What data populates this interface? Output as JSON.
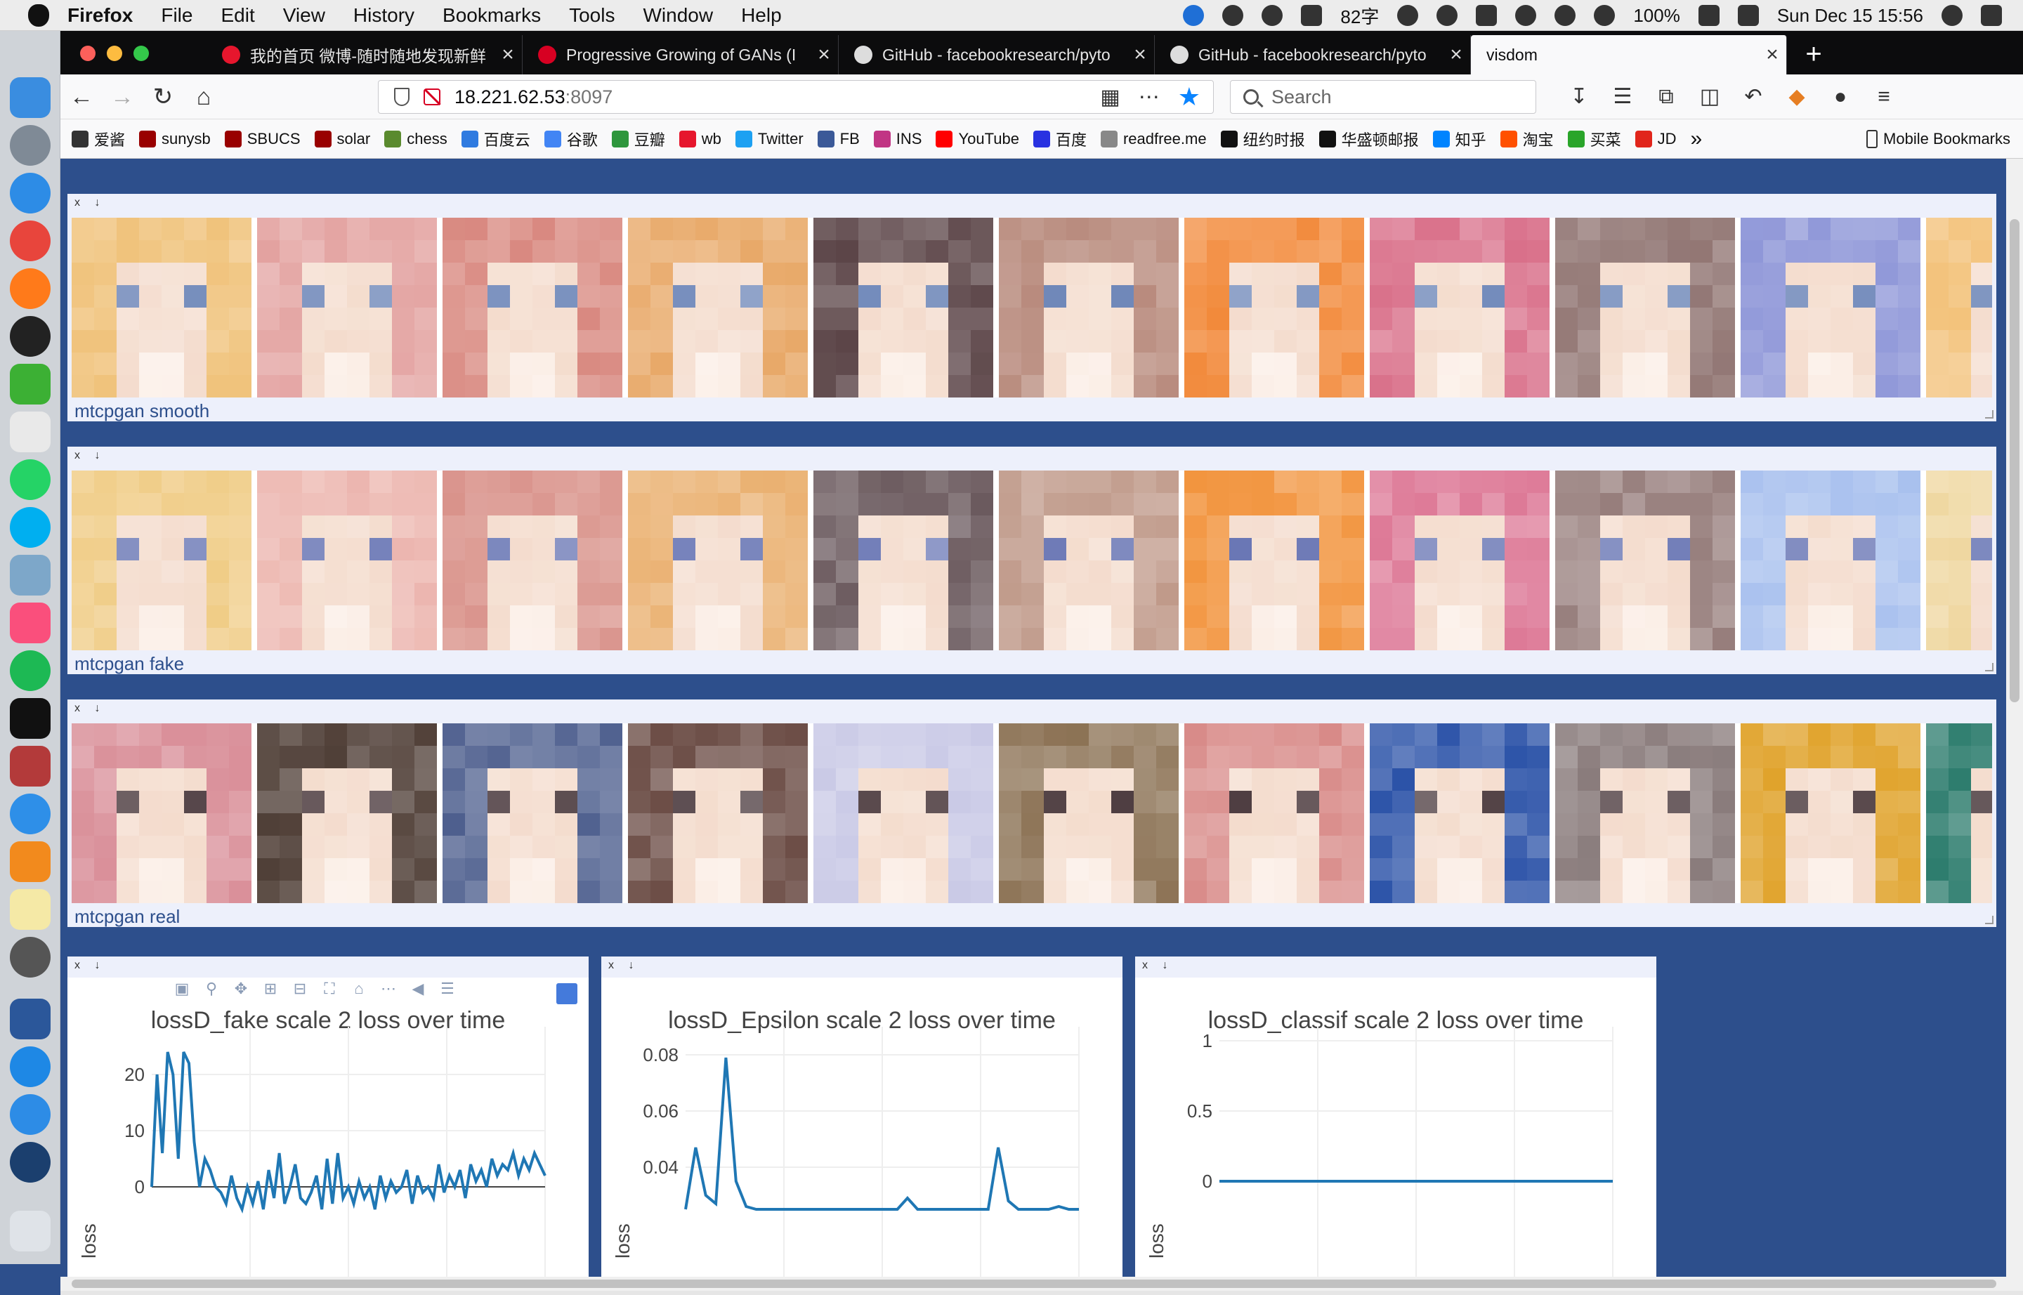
{
  "menubar": {
    "app": "Firefox",
    "items": [
      "File",
      "Edit",
      "View",
      "History",
      "Bookmarks",
      "Tools",
      "Window",
      "Help"
    ],
    "word_count": "82字",
    "battery": "100%",
    "clock": "Sun Dec 15  15:56"
  },
  "browser": {
    "tabs": [
      {
        "title": "我的首页 微博-随时随地发现新鲜",
        "fav_color": "#e6162d"
      },
      {
        "title": "Progressive Growing of GANs (I",
        "fav_color": "#d70022"
      },
      {
        "title": "GitHub - facebookresearch/pyto",
        "fav_color": "#ffffff"
      },
      {
        "title": "GitHub - facebookresearch/pyto",
        "fav_color": "#ffffff"
      },
      {
        "title": "visdom",
        "fav_color": ""
      }
    ],
    "new_tab_symbol": "+",
    "url_host": "18.221.62.53",
    "url_port": ":8097",
    "search_placeholder": "Search",
    "bookmarks": [
      {
        "label": "爱酱",
        "color": "#333333"
      },
      {
        "label": "sunysb",
        "color": "#990000"
      },
      {
        "label": "SBUCS",
        "color": "#990000"
      },
      {
        "label": "solar",
        "color": "#990000"
      },
      {
        "label": "chess",
        "color": "#5a8a2e"
      },
      {
        "label": "百度云",
        "color": "#2f7be0"
      },
      {
        "label": "谷歌",
        "color": "#4285f4"
      },
      {
        "label": "豆瓣",
        "color": "#2e963d"
      },
      {
        "label": "wb",
        "color": "#e6162d"
      },
      {
        "label": "Twitter",
        "color": "#1da1f2"
      },
      {
        "label": "FB",
        "color": "#3b5998"
      },
      {
        "label": "INS",
        "color": "#c13584"
      },
      {
        "label": "YouTube",
        "color": "#ff0000"
      },
      {
        "label": "百度",
        "color": "#2932e1"
      },
      {
        "label": "readfree.me",
        "color": "#888888"
      },
      {
        "label": "纽约时报",
        "color": "#111111"
      },
      {
        "label": "华盛顿邮报",
        "color": "#111111"
      },
      {
        "label": "知乎",
        "color": "#0084ff"
      },
      {
        "label": "淘宝",
        "color": "#ff5000"
      },
      {
        "label": "买菜",
        "color": "#2aa52a"
      },
      {
        "label": "JD",
        "color": "#e1251b"
      }
    ],
    "bookmarks_overflow": "»",
    "mobile_bookmarks": "Mobile Bookmarks"
  },
  "visdom": {
    "pane_controls": "x ↓",
    "image_panes": [
      {
        "caption": "mtcpgan smooth"
      },
      {
        "caption": "mtcpgan fake"
      },
      {
        "caption": "mtcpgan real"
      }
    ]
  },
  "chart_data": [
    {
      "type": "line",
      "title": "lossD_fake scale 2 loss over time",
      "xlabel": "",
      "ylabel": "loss",
      "yticks": [
        0,
        10,
        20
      ],
      "ylim_visible": [
        -4,
        26
      ],
      "grid": true,
      "series": [
        {
          "values": [
            0,
            20,
            6,
            24,
            20,
            5,
            24,
            22,
            8,
            0,
            5,
            3,
            0,
            -1,
            -3,
            2,
            -2,
            -4,
            0,
            -3,
            1,
            -4,
            3,
            -2,
            6,
            -3,
            0,
            4,
            -2,
            -3,
            -1,
            2,
            -4,
            5,
            -3,
            6,
            -2,
            0,
            -3,
            1,
            -2,
            0,
            -4,
            2,
            -2,
            1,
            -1,
            0,
            3,
            -3,
            2,
            -1,
            0,
            -2,
            4,
            -1,
            2,
            0,
            3,
            -2,
            4,
            1,
            3,
            0,
            5,
            2,
            4,
            3,
            6,
            2,
            5,
            3,
            6,
            4,
            2
          ]
        }
      ]
    },
    {
      "type": "line",
      "title": "lossD_Epsilon scale 2 loss over time",
      "xlabel": "",
      "ylabel": "loss",
      "yticks": [
        0.04,
        0.06,
        0.08
      ],
      "ylim_visible": [
        0.025,
        0.085
      ],
      "grid": true,
      "series": [
        {
          "values": [
            0.025,
            0.047,
            0.03,
            0.027,
            0.079,
            0.035,
            0.026,
            0.025,
            0.025,
            0.025,
            0.025,
            0.025,
            0.025,
            0.025,
            0.025,
            0.025,
            0.025,
            0.025,
            0.025,
            0.025,
            0.025,
            0.025,
            0.029,
            0.025,
            0.025,
            0.025,
            0.025,
            0.025,
            0.025,
            0.025,
            0.025,
            0.047,
            0.028,
            0.025,
            0.025,
            0.025,
            0.025,
            0.026,
            0.025,
            0.025
          ]
        }
      ]
    },
    {
      "type": "line",
      "title": "lossD_classif scale 2 loss over time",
      "xlabel": "",
      "ylabel": "loss",
      "yticks": [
        0,
        0.5,
        1
      ],
      "ylim": [
        -0.2,
        1
      ],
      "grid": true,
      "series": [
        {
          "values": [
            0,
            0,
            0,
            0,
            0,
            0,
            0,
            0,
            0,
            0,
            0,
            0,
            0,
            0,
            0,
            0,
            0,
            0,
            0,
            0
          ]
        }
      ]
    }
  ]
}
